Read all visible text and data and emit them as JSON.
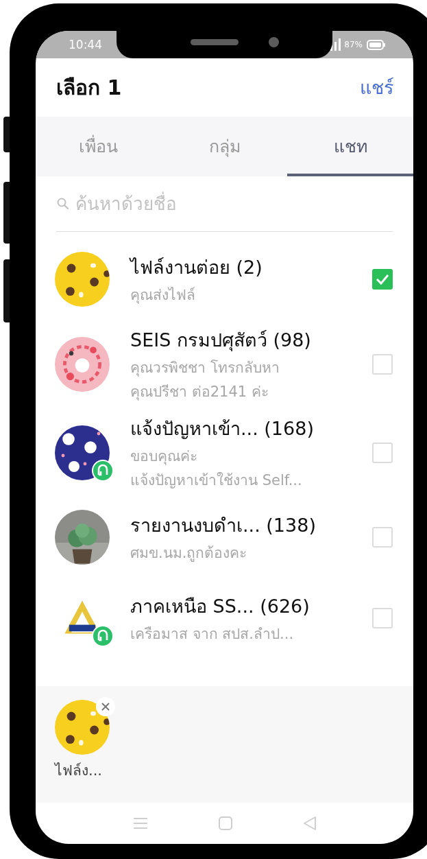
{
  "status_bar": {
    "time": "10:44",
    "battery": "87%"
  },
  "header": {
    "title": "เลือก 1",
    "action": "แชร์"
  },
  "tabs": [
    {
      "label": "เพื่อน",
      "selected": false
    },
    {
      "label": "กลุ่ม",
      "selected": false
    },
    {
      "label": "แชท",
      "selected": true
    }
  ],
  "search": {
    "placeholder": "ค้นหาด้วยชื่อ"
  },
  "chats": [
    {
      "name": "ไฟล์งานต่อย (2)",
      "lines": [
        "คุณส่งไฟล์"
      ],
      "checked": true,
      "badge": false
    },
    {
      "name": "SEIS กรมปศุสัตว์ (98)",
      "lines": [
        "คุณวรพิชชา โทรกลับหา",
        "คุณปรีชา ต่อ2141 ค่ะ"
      ],
      "checked": false,
      "badge": false
    },
    {
      "name": "แจ้งปัญหาเข้า... (168)",
      "lines": [
        "ขอบคุณค่ะ",
        "แจ้งปัญหาเข้าใช้งาน Self..."
      ],
      "checked": false,
      "badge": true
    },
    {
      "name": "รายงานงบดำเ... (138)",
      "lines": [
        "ศมข.นม.ถูกต้องคะ"
      ],
      "checked": false,
      "badge": false
    },
    {
      "name": "ภาคเหนือ SS...  (626)",
      "lines": [
        "เครือมาส จาก สปส.ลำป..."
      ],
      "checked": false,
      "badge": true
    }
  ],
  "selected_items": [
    {
      "label": "ไฟล์ง..."
    }
  ]
}
